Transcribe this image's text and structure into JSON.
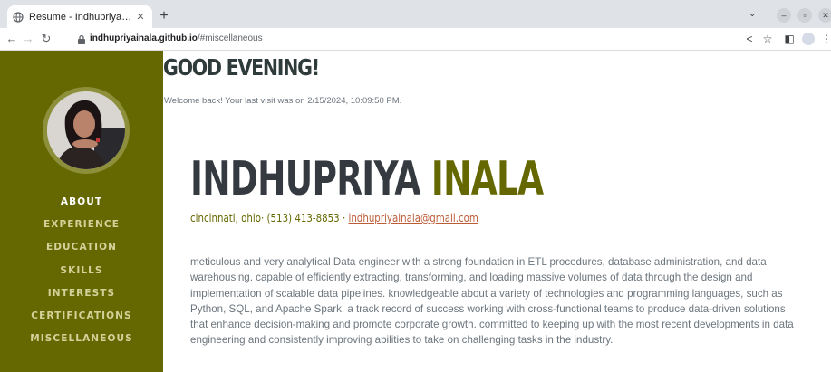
{
  "browser": {
    "tab_title": "Resume - Indhupriya Inala",
    "url_domain": "indhupriyainala.github.io",
    "url_path": "/#miscellaneous"
  },
  "sidebar": {
    "items": [
      {
        "label": "ABOUT",
        "active": true
      },
      {
        "label": "EXPERIENCE",
        "active": false
      },
      {
        "label": "EDUCATION",
        "active": false
      },
      {
        "label": "SKILLS",
        "active": false
      },
      {
        "label": "INTERESTS",
        "active": false
      },
      {
        "label": "CERTIFICATIONS",
        "active": false
      },
      {
        "label": "MISCELLANEOUS",
        "active": false
      }
    ]
  },
  "main": {
    "greeting": "GOOD EVENING!",
    "welcome": "Welcome back! Your last visit was on 2/15/2024, 10:09:50 PM.",
    "first_name": "INDHUPRIYA",
    "last_name": "INALA",
    "contact_text": "cincinnati, ohio· (513) 413-8853 · ",
    "email": "indhupriyainala@gmail.com",
    "summary": "meticulous and very analytical Data engineer with a strong foundation in ETL procedures, database administration, and data warehousing. capable of efficiently extracting, transforming, and loading massive volumes of data through the design and implementation of scalable data pipelines. knowledgeable about a variety of technologies and programming languages, such as Python, SQL, and Apache Spark. a track record of success working with cross-functional teams to produce data-driven solutions that enhance decision-making and promote corporate growth. committed to keeping up with the most recent developments in data engineering and consistently improving abilities to take on challenging tasks in the industry."
  },
  "colors": {
    "sidebar": "#656800",
    "accent": "#656800",
    "link": "#bd5d38",
    "heading": "#343a40"
  }
}
